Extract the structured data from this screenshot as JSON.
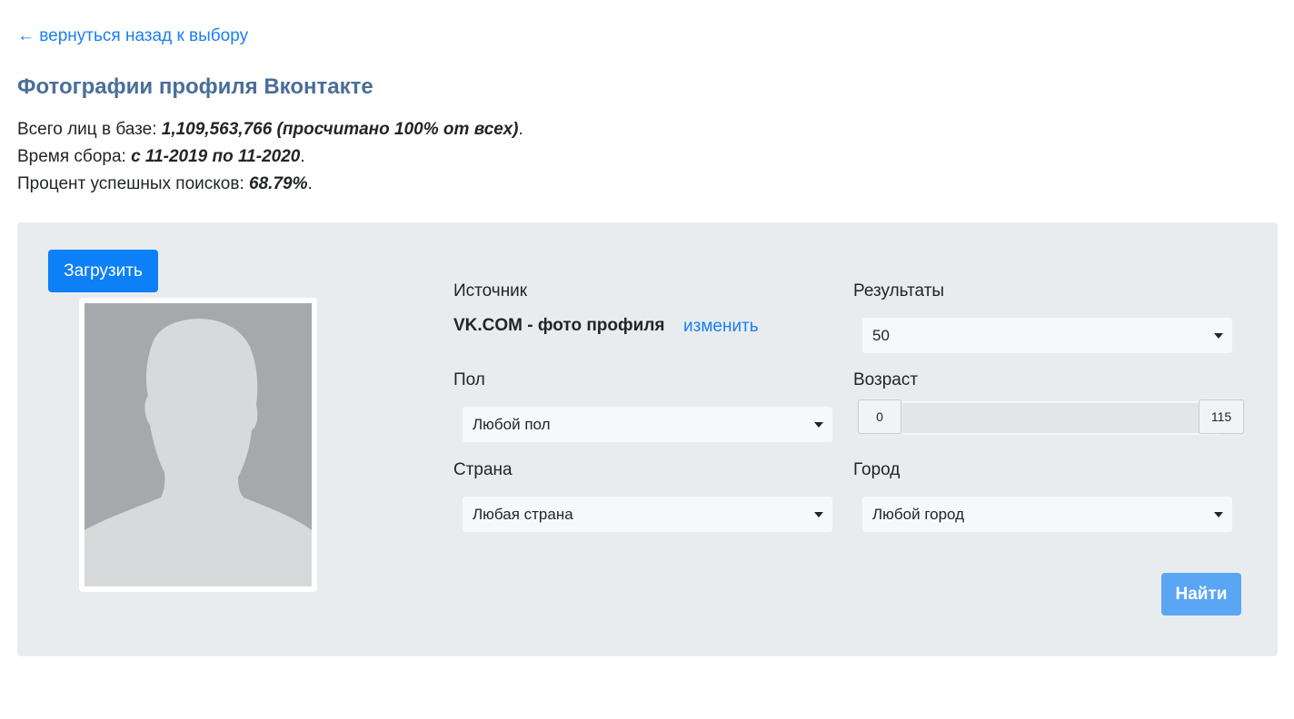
{
  "nav": {
    "back_label": "← вернуться назад к выбору"
  },
  "page": {
    "title": "Фотографии профиля Вконтакте"
  },
  "stats": {
    "faces_label": "Всего лиц в базе: ",
    "faces_value": "1,109,563,766 (просчитано 100% от всех)",
    "period_label": "Время сбора: ",
    "period_value": "с 11-2019 по 11-2020",
    "success_label": "Процент успешных поисков: ",
    "success_value": "68.79%",
    "end": "."
  },
  "upload": {
    "button_label": "Загрузить",
    "photo_icon": "person-silhouette-icon"
  },
  "form": {
    "source_label": "Источник",
    "source_value": "VK.COM - фото профиля",
    "change_label": "изменить",
    "results_label": "Результаты",
    "results_value": "50",
    "gender_label": "Пол",
    "gender_value": "Любой пол",
    "age_label": "Возраст",
    "age_min": "0",
    "age_max": "115",
    "country_label": "Страна",
    "country_value": "Любая страна",
    "city_label": "Город",
    "city_value": "Любой город",
    "search_label": "Найти"
  },
  "colors": {
    "link": "#1a7ff2",
    "title": "#4a6e99",
    "panel_bg": "#e9ecef",
    "primary_button": "#0d7ff7",
    "search_button": "#5aa6f5"
  }
}
